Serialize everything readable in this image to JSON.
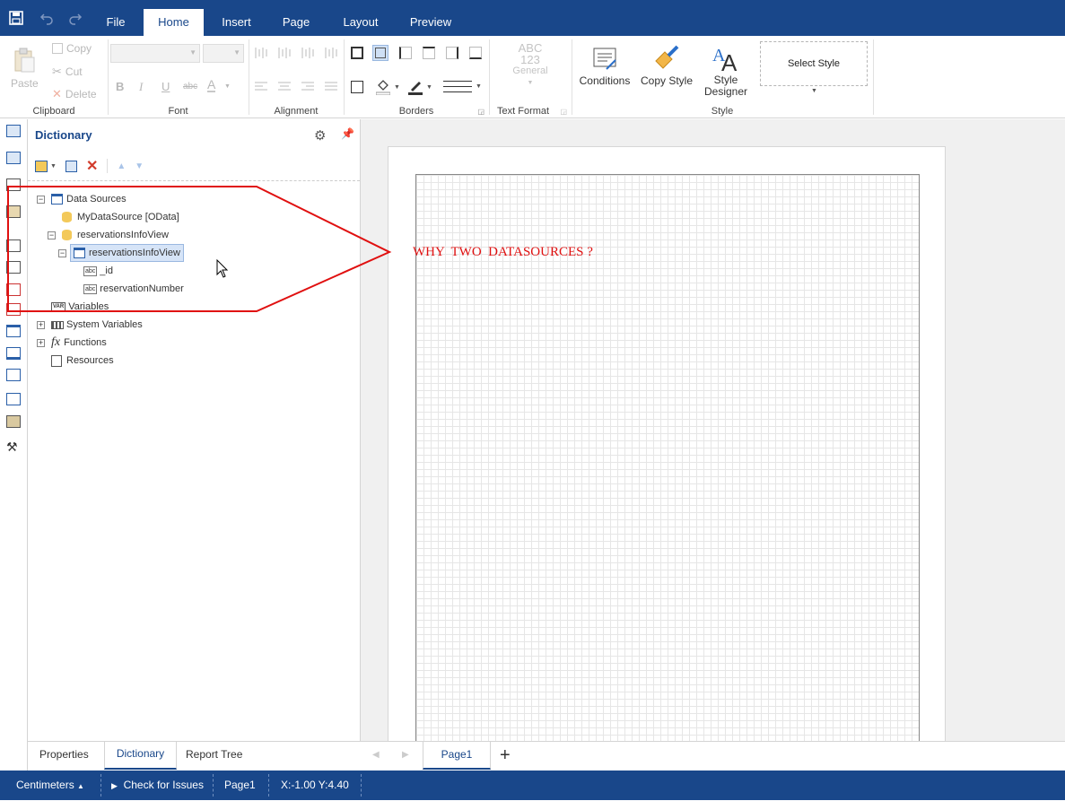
{
  "menu": {
    "tabs": [
      "File",
      "Home",
      "Insert",
      "Page",
      "Layout",
      "Preview"
    ],
    "active": "Home"
  },
  "ribbon": {
    "clipboard": {
      "paste": "Paste",
      "copy": "Copy",
      "cut": "Cut",
      "delete": "Delete",
      "group": "Clipboard"
    },
    "font": {
      "bold": "B",
      "italic": "I",
      "underline": "U",
      "strike": "abc",
      "color": "A",
      "group": "Font"
    },
    "alignment": {
      "group": "Alignment"
    },
    "borders": {
      "group": "Borders"
    },
    "text_format": {
      "abc": "ABC",
      "num": "123",
      "general": "General",
      "group": "Text Format"
    },
    "style": {
      "conditions": "Conditions",
      "copy_style": "Copy Style",
      "style_designer_1": "Style",
      "style_designer_2": "Designer",
      "select_style": "Select Style",
      "group": "Style"
    }
  },
  "dictionary": {
    "title": "Dictionary",
    "tree": {
      "data_sources": "Data Sources",
      "my_data_source": "MyDataSource [OData]",
      "reservations_source": "reservationsInfoView",
      "reservations_table": "reservationsInfoView",
      "field_id": "_id",
      "field_reservation": "reservationNumber",
      "variables": "Variables",
      "system_variables": "System Variables",
      "functions": "Functions",
      "resources": "Resources"
    },
    "icon_text": {
      "abc": "abc",
      "var": "VAR",
      "fx": "fx"
    }
  },
  "annotation": {
    "text": "WHY  TWO  DATASOURCES ?",
    "color": "#e01010"
  },
  "bottom_tabs": [
    "Properties",
    "Dictionary",
    "Report Tree"
  ],
  "active_bottom_tab": "Dictionary",
  "page_tab": "Page1",
  "status": {
    "units": "Centimeters",
    "check": "Check for Issues",
    "page": "Page1",
    "coords": "X:-1.00 Y:4.40"
  },
  "colors": {
    "brand": "#19478a",
    "accent": "#2a5fa8",
    "annotation": "#e01010"
  }
}
